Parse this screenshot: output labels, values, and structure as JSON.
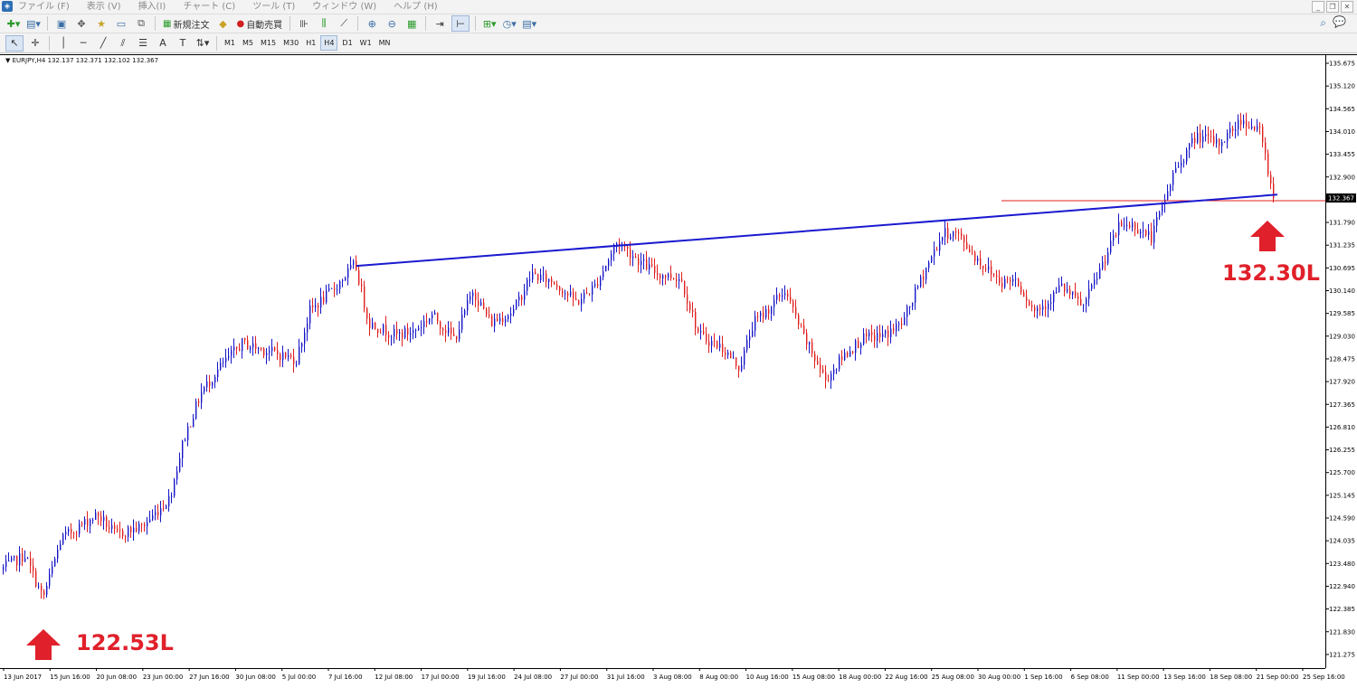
{
  "menu": {
    "items": [
      "ファイル (F)",
      "表示 (V)",
      "挿入(I)",
      "チャート (C)",
      "ツール (T)",
      "ウィンドウ (W)",
      "ヘルプ (H)"
    ]
  },
  "toolbar": {
    "new_order_label": "新規注文",
    "auto_trade_label": "自動売買",
    "timeframes": [
      "M1",
      "M5",
      "M15",
      "M30",
      "H1",
      "H4",
      "D1",
      "W1",
      "MN"
    ],
    "active_timeframe": "H4"
  },
  "chart": {
    "symbol_label": "EURJPY,H4  132.137 132.371 132.102 132.367",
    "current_price_label": "132.367",
    "annotation_low": "122.53L",
    "annotation_high": "132.30L",
    "price_axis": [
      "135.675",
      "135.120",
      "134.565",
      "134.010",
      "133.455",
      "132.900",
      "132.367",
      "131.790",
      "131.235",
      "130.695",
      "130.140",
      "129.585",
      "129.030",
      "128.475",
      "127.920",
      "127.365",
      "126.810",
      "126.255",
      "125.700",
      "125.145",
      "124.590",
      "124.035",
      "123.480",
      "122.940",
      "122.385",
      "121.830",
      "121.275"
    ],
    "time_axis": [
      "13 Jun 2017",
      "15 Jun 16:00",
      "20 Jun 08:00",
      "23 Jun 00:00",
      "27 Jun 16:00",
      "30 Jun 08:00",
      "5 Jul 00:00",
      "7 Jul 16:00",
      "12 Jul 08:00",
      "17 Jul 00:00",
      "19 Jul 16:00",
      "24 Jul 08:00",
      "27 Jul 00:00",
      "31 Jul 16:00",
      "3 Aug 08:00",
      "8 Aug 00:00",
      "10 Aug 16:00",
      "15 Aug 08:00",
      "18 Aug 00:00",
      "22 Aug 16:00",
      "25 Aug 08:00",
      "30 Aug 00:00",
      "1 Sep 16:00",
      "6 Sep 08:00",
      "11 Sep 00:00",
      "13 Sep 16:00",
      "18 Sep 08:00",
      "21 Sep 00:00",
      "25 Sep 16:00"
    ],
    "colors": {
      "bull": "#1515c8",
      "bear": "#e01e1e",
      "trendline": "#1a1ad0",
      "support": "#e02020",
      "annotation": "#e0202a"
    }
  },
  "chart_data": {
    "type": "candlestick",
    "symbol": "EURJPY",
    "timeframe": "H4",
    "ohlc_last": {
      "open": 132.137,
      "high": 132.371,
      "low": 132.102,
      "close": 132.367
    },
    "ylim": [
      121.275,
      135.675
    ],
    "path_anchors": [
      [
        0,
        123.2
      ],
      [
        30,
        123.6
      ],
      [
        50,
        122.53
      ],
      [
        70,
        124.0
      ],
      [
        110,
        124.6
      ],
      [
        130,
        124.1
      ],
      [
        160,
        124.3
      ],
      [
        190,
        125.0
      ],
      [
        205,
        126.4
      ],
      [
        225,
        127.6
      ],
      [
        245,
        128.2
      ],
      [
        270,
        128.8
      ],
      [
        300,
        128.6
      ],
      [
        330,
        128.4
      ],
      [
        345,
        129.6
      ],
      [
        370,
        130.1
      ],
      [
        395,
        130.75
      ],
      [
        410,
        129.3
      ],
      [
        440,
        129.0
      ],
      [
        460,
        129.1
      ],
      [
        480,
        129.5
      ],
      [
        505,
        128.9
      ],
      [
        525,
        130.1
      ],
      [
        545,
        129.3
      ],
      [
        570,
        129.6
      ],
      [
        590,
        130.5
      ],
      [
        615,
        130.3
      ],
      [
        640,
        129.8
      ],
      [
        660,
        130.2
      ],
      [
        685,
        131.3
      ],
      [
        710,
        130.8
      ],
      [
        730,
        130.5
      ],
      [
        755,
        130.4
      ],
      [
        775,
        129.0
      ],
      [
        800,
        128.7
      ],
      [
        820,
        128.2
      ],
      [
        835,
        129.3
      ],
      [
        850,
        129.6
      ],
      [
        870,
        130.1
      ],
      [
        890,
        129.0
      ],
      [
        915,
        127.9
      ],
      [
        935,
        128.5
      ],
      [
        955,
        128.9
      ],
      [
        980,
        129.0
      ],
      [
        1000,
        129.3
      ],
      [
        1025,
        130.6
      ],
      [
        1045,
        131.5
      ],
      [
        1060,
        131.5
      ],
      [
        1085,
        130.8
      ],
      [
        1110,
        130.3
      ],
      [
        1125,
        130.4
      ],
      [
        1145,
        129.6
      ],
      [
        1160,
        129.8
      ],
      [
        1175,
        130.2
      ],
      [
        1200,
        129.7
      ],
      [
        1220,
        130.7
      ],
      [
        1240,
        131.7
      ],
      [
        1255,
        131.7
      ],
      [
        1275,
        131.4
      ],
      [
        1288,
        132.2
      ],
      [
        1300,
        133.0
      ],
      [
        1325,
        133.9
      ],
      [
        1350,
        133.7
      ],
      [
        1375,
        134.3
      ],
      [
        1395,
        134.0
      ],
      [
        1403,
        133.2
      ],
      [
        1410,
        132.3
      ]
    ],
    "trendline": [
      [
        394,
        130.7
      ],
      [
        1412,
        132.45
      ]
    ],
    "support_level": {
      "price": 132.3,
      "x_start": 1107
    }
  }
}
